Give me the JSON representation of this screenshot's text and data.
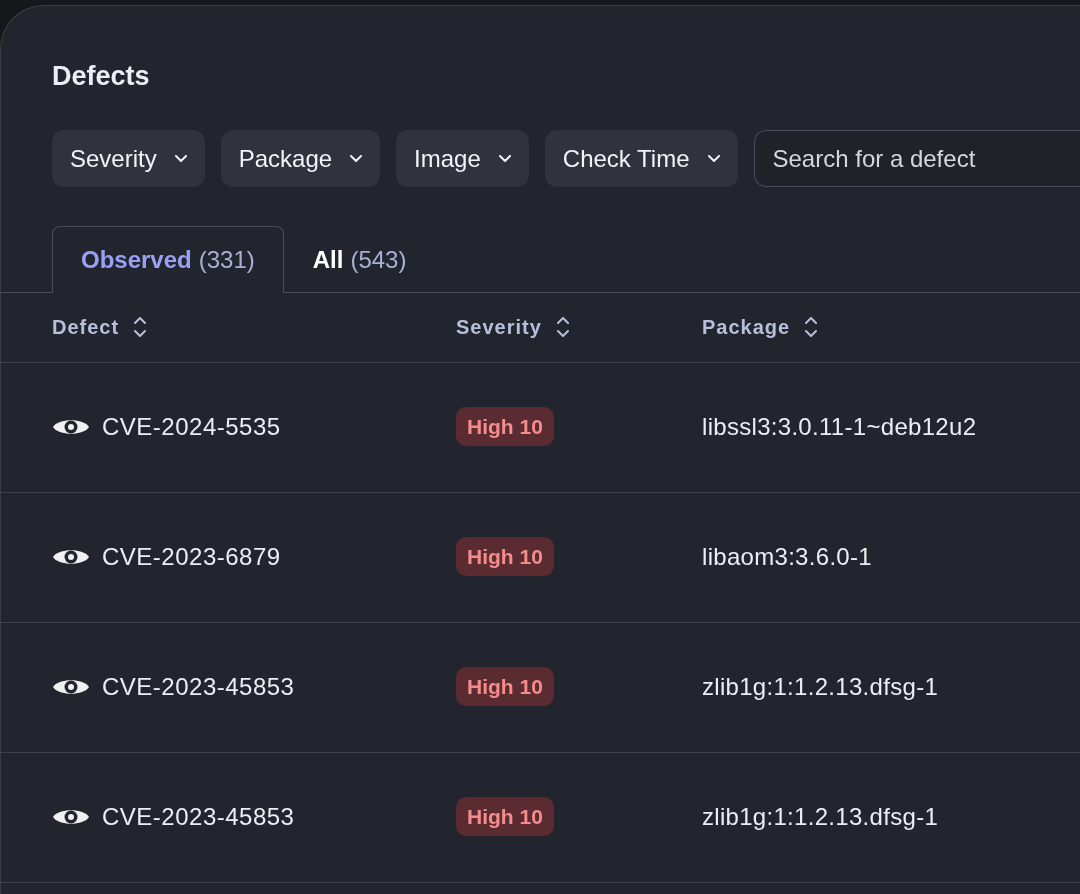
{
  "title": "Defects",
  "filters": [
    {
      "label": "Severity"
    },
    {
      "label": "Package"
    },
    {
      "label": "Image"
    },
    {
      "label": "Check Time"
    }
  ],
  "search": {
    "placeholder": "Search for a defect"
  },
  "tabs": [
    {
      "label": "Observed",
      "count": "(331)",
      "selected": true
    },
    {
      "label": "All",
      "count": "(543)",
      "selected": false
    }
  ],
  "table": {
    "columns": [
      "Defect",
      "Severity",
      "Package"
    ],
    "rows": [
      {
        "defect": "CVE-2024-5535",
        "severity": "High 10",
        "package": "libssl3:3.0.11-1~deb12u2"
      },
      {
        "defect": "CVE-2023-6879",
        "severity": "High 10",
        "package": "libaom3:3.6.0-1"
      },
      {
        "defect": "CVE-2023-45853",
        "severity": "High 10",
        "package": "zlib1g:1:1.2.13.dfsg-1"
      },
      {
        "defect": "CVE-2023-45853",
        "severity": "High 10",
        "package": "zlib1g:1:1.2.13.dfsg-1"
      }
    ]
  }
}
